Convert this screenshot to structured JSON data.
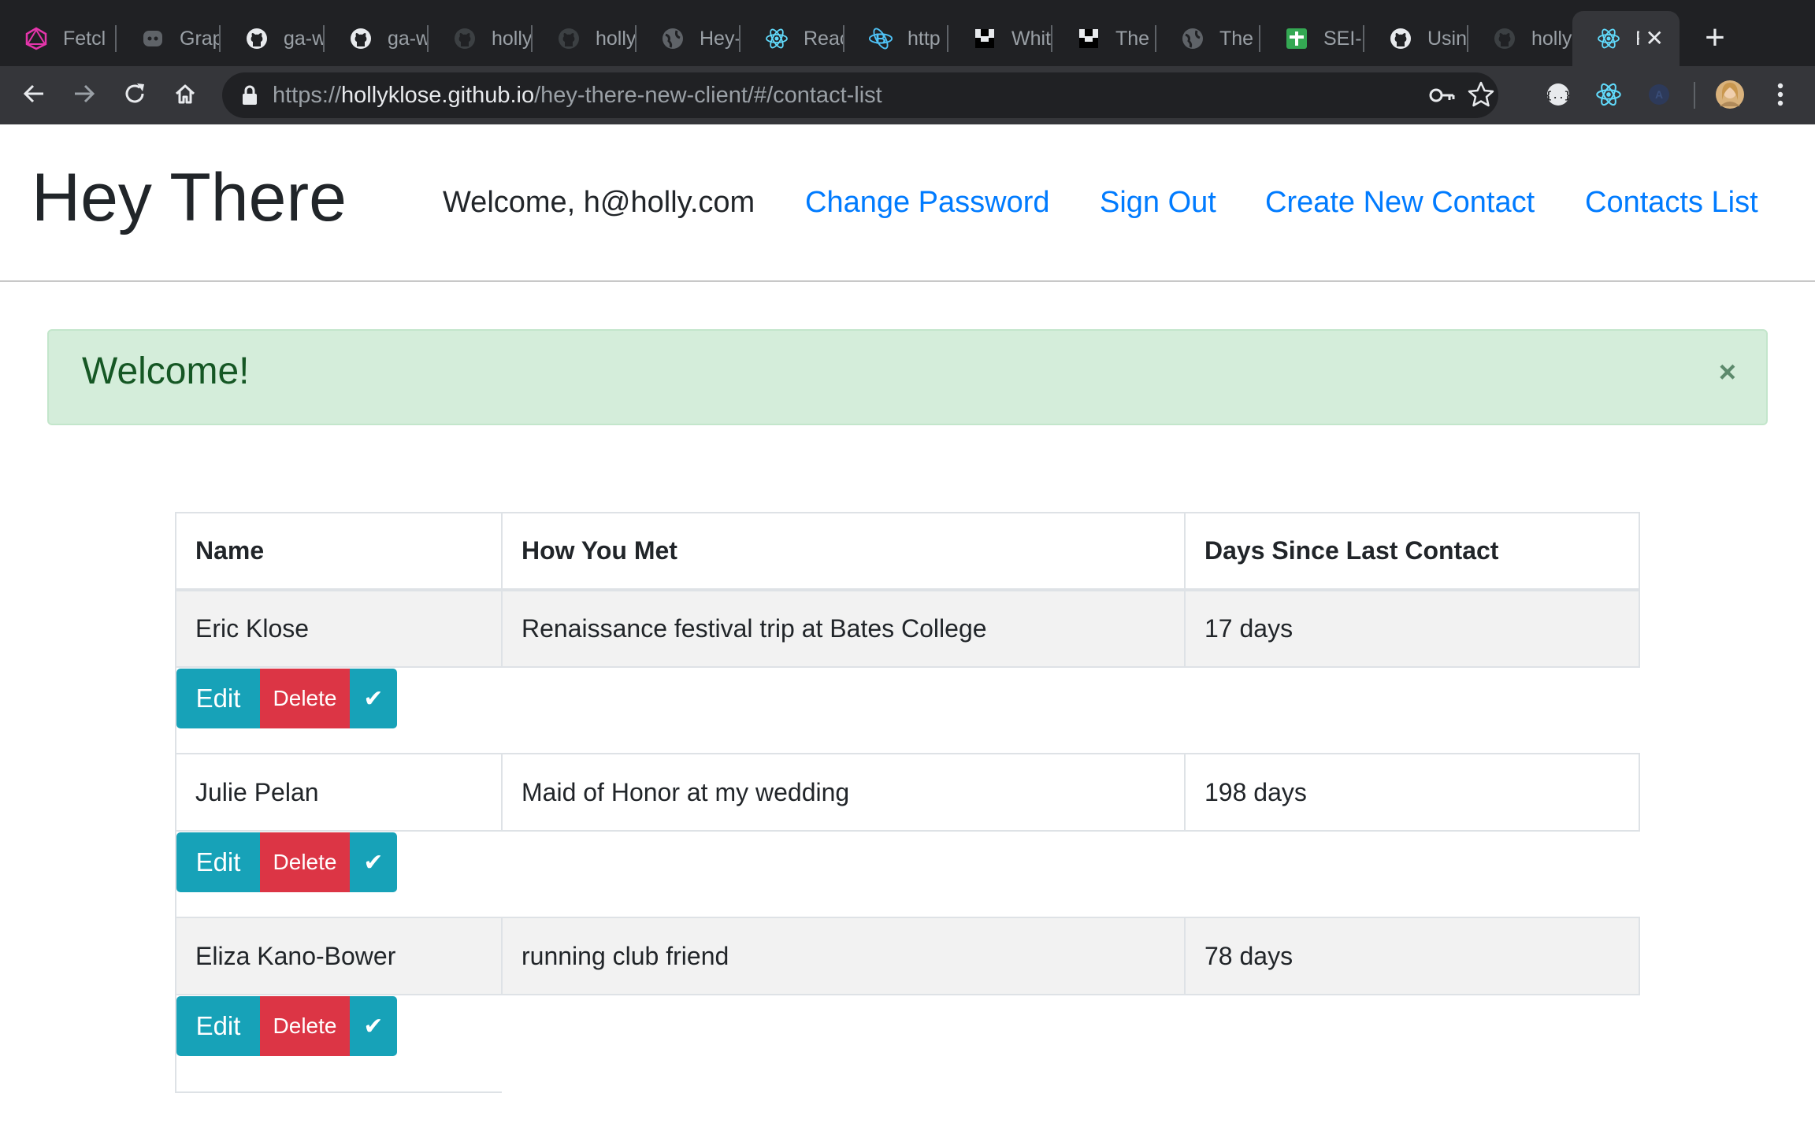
{
  "browser": {
    "tabs": [
      {
        "label": "Fetcl",
        "icon": "graphql-icon"
      },
      {
        "label": "Grap",
        "icon": "discord-icon"
      },
      {
        "label": "ga-w",
        "icon": "github-icon"
      },
      {
        "label": "ga-w",
        "icon": "github-icon"
      },
      {
        "label": "holly",
        "icon": "github-icon"
      },
      {
        "label": "holly",
        "icon": "github-icon"
      },
      {
        "label": "Hey-",
        "icon": "globe-icon"
      },
      {
        "label": "Reac",
        "icon": "react-icon"
      },
      {
        "label": "http",
        "icon": "bootstrap-icon"
      },
      {
        "label": "Whit",
        "icon": "unsplash-icon"
      },
      {
        "label": "The",
        "icon": "unsplash-icon"
      },
      {
        "label": "The",
        "icon": "globe-icon"
      },
      {
        "label": "SEI-",
        "icon": "sheets-icon"
      },
      {
        "label": "Usin",
        "icon": "github-icon"
      },
      {
        "label": "holly",
        "icon": "github-icon"
      },
      {
        "label": "R",
        "icon": "react-icon",
        "active": true
      }
    ],
    "new_tab_label": "+",
    "close_tab_label": "✕",
    "url_scheme": "https://",
    "url_host": "hollyklose.github.io",
    "url_path": "/hey-there-new-client/#/contact-list"
  },
  "header": {
    "brand": "Hey There",
    "welcome": "Welcome, h@holly.com",
    "nav": {
      "change_password": "Change Password",
      "sign_out": "Sign Out",
      "create_contact": "Create New Contact",
      "contacts_list": "Contacts List"
    }
  },
  "alert": {
    "message": "Welcome!",
    "close": "×"
  },
  "table": {
    "headers": [
      "Name",
      "How You Met",
      "Days Since Last Contact"
    ],
    "rows": [
      {
        "name": "Eric Klose",
        "met": "Renaissance festival trip at Bates College",
        "days": "17 days"
      },
      {
        "name": "Julie Pelan",
        "met": "Maid of Honor at my wedding",
        "days": "198 days"
      },
      {
        "name": "Eliza Kano-Bower",
        "met": "running club friend",
        "days": "78 days"
      }
    ],
    "buttons": {
      "edit": "Edit",
      "delete": "Delete",
      "check": "✔"
    }
  },
  "colors": {
    "link": "#007bff",
    "info": "#17a2b8",
    "danger": "#dc3545",
    "alert_bg": "#d4edda",
    "alert_text": "#155724"
  }
}
